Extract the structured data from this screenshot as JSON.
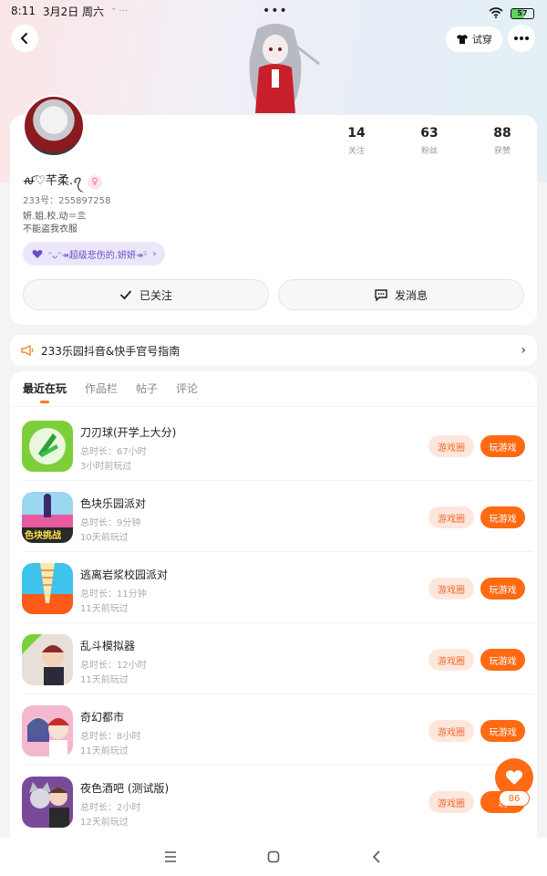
{
  "status_bar": {
    "time": "8:11",
    "date": "3月2日 周六",
    "extra": "⁺ ···",
    "center_dots": "•••",
    "battery": "57"
  },
  "header": {
    "tryon_label": "试穿"
  },
  "profile": {
    "stats": [
      {
        "value": "14",
        "label": "关注"
      },
      {
        "value": "63",
        "label": "粉丝"
      },
      {
        "value": "88",
        "label": "获赞"
      }
    ],
    "nickname": "ꫛ♡芊柔.ꪖ",
    "uid": "233号：255897258",
    "bio_line1": "妍.姐.校.动＝亖",
    "bio_line2": "不能盗我衣服",
    "fan_tag": "ᵔᴗᵔ↠超级悲伤的.妍妍↠ᵕ̈",
    "follow_label": "已关注",
    "message_label": "发消息"
  },
  "notice": {
    "text": "233乐园抖音&快手官号指南"
  },
  "tabs": [
    {
      "label": "最近在玩",
      "active": true
    },
    {
      "label": "作品栏",
      "active": false
    },
    {
      "label": "帖子",
      "active": false
    },
    {
      "label": "评论",
      "active": false
    }
  ],
  "games": [
    {
      "name": "刀刃球(开学上大分)",
      "duration": "总时长：67小时",
      "last": "3小时前玩过",
      "circle": "游戏圈",
      "play": "玩游戏"
    },
    {
      "name": "色块乐园派对",
      "duration": "总时长：9分钟",
      "last": "10天前玩过",
      "circle": "游戏圈",
      "play": "玩游戏",
      "badge": "色块挑战"
    },
    {
      "name": "逃离岩浆校园派对",
      "duration": "总时长：11分钟",
      "last": "11天前玩过",
      "circle": "游戏圈",
      "play": "玩游戏"
    },
    {
      "name": "乱斗模拟器",
      "duration": "总时长：12小时",
      "last": "11天前玩过",
      "circle": "游戏圈",
      "play": "玩游戏"
    },
    {
      "name": "奇幻都市",
      "duration": "总时长：8小时",
      "last": "11天前玩过",
      "circle": "游戏圈",
      "play": "玩游戏"
    },
    {
      "name": "夜色酒吧 (测试版)",
      "duration": "总时长：2小时",
      "last": "12天前玩过",
      "circle": "游戏圈",
      "play": "玩"
    }
  ],
  "float": {
    "count": "86"
  },
  "colors": {
    "accent": "#ff6a13",
    "circle_bg": "#fde7dc",
    "tag_bg": "#ece6fb"
  }
}
